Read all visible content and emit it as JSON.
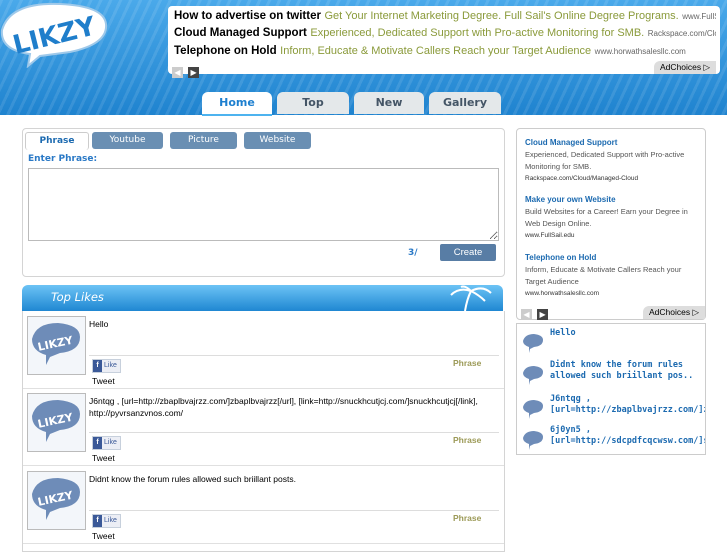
{
  "ads_top": [
    {
      "title": "How to advertise on twitter",
      "desc": "Get Your Internet Marketing Degree. Full Sail's Online Degree Programs.",
      "url": "www.FullSa..."
    },
    {
      "title": "Cloud Managed Support",
      "desc": "Experienced, Dedicated Support with Pro-active Monitoring for SMB.",
      "url": "Rackspace.com/Cloud..."
    },
    {
      "title": "Telephone on Hold",
      "desc": "Inform, Educate & Motivate Callers Reach your Target Audience",
      "url": "www.horwathsalesllc.com"
    }
  ],
  "adchoices_label": "AdChoices",
  "nav_tabs": [
    "Home",
    "Top",
    "New",
    "Gallery"
  ],
  "phrase_tabs": [
    "Phrase",
    "Youtube",
    "Picture",
    "Website"
  ],
  "enter_label": "Enter Phrase:",
  "char_count": "3/",
  "create_label": "Create",
  "top_likes_title": "Top Likes",
  "likes": [
    {
      "text": "Hello",
      "type": "Phrase",
      "like": "Like",
      "tweet": "Tweet"
    },
    {
      "text": "J6ntqg , [url=http://zbaplbvajrzz.com/]zbaplbvajrzz[/url], [link=http://snuckhcutjcj.com/]snuckhcutjcj[/link], http://pyvrsanzvnos.com/",
      "type": "Phrase",
      "like": "Like",
      "tweet": "Tweet"
    },
    {
      "text": "Didnt know the forum rules allowed such briillant posts.",
      "type": "Phrase",
      "like": "Like",
      "tweet": "Tweet"
    }
  ],
  "side_ads": [
    {
      "title": "Cloud Managed Support",
      "desc": "Experienced, Dedicated Support with Pro-active Monitoring for SMB.",
      "url": "Rackspace.com/Cloud/Managed-Cloud"
    },
    {
      "title": "Make your own Website",
      "desc": "Build Websites for a Career! Earn your Degree in Web Design Online.",
      "url": "www.FullSail.edu"
    },
    {
      "title": "Telephone on Hold",
      "desc": "Inform, Educate & Motivate Callers Reach your Target Audience",
      "url": "www.horwathsalesllc.com"
    }
  ],
  "recent": [
    {
      "line1": "Hello",
      "line2": ""
    },
    {
      "line1": "Didnt know the forum rules",
      "line2": "allowed such briillant pos.."
    },
    {
      "line1": "J6ntqg ,",
      "line2": "[url=http://zbaplbvajrzz.com/]zb"
    },
    {
      "line1": "6j0yn5 ,",
      "line2": "[url=http://sdcpdfcqcwsw.com/]s"
    }
  ],
  "logo_text": "LIKZY",
  "colors": {
    "header": "#2b8fd6",
    "accent": "#1c6ab0",
    "phrase_tag": "#9c9a57"
  }
}
